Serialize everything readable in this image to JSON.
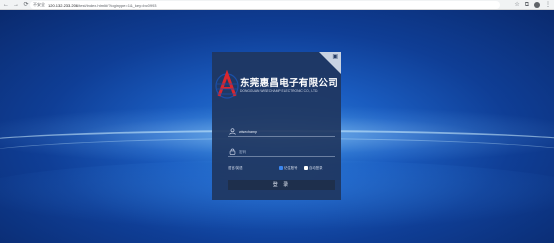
{
  "browser": {
    "address_warning": "不安全",
    "address_host": "120.132.233.206",
    "address_path": "/test/index.html#/?loginype=1&_key=bc0993"
  },
  "login": {
    "company_name_cn": "东莞惠昌电子有限公司",
    "company_name_en": "DONGGUAN WISECHAMP ELECTRONIC CO., LTD.",
    "username_value": "wisechamp",
    "password_placeholder": "密码",
    "language_label": "语言/英语",
    "remember_label": "记住账号",
    "auto_login_label": "自动登录",
    "remember_checked": true,
    "auto_login_checked": false,
    "submit_label": "登 录"
  },
  "colors": {
    "panel": "#203660",
    "button": "#1e2f4c",
    "checkbox_active": "#3a86f0",
    "logo_red": "#d9262e",
    "logo_blue": "#1b4fa8"
  }
}
